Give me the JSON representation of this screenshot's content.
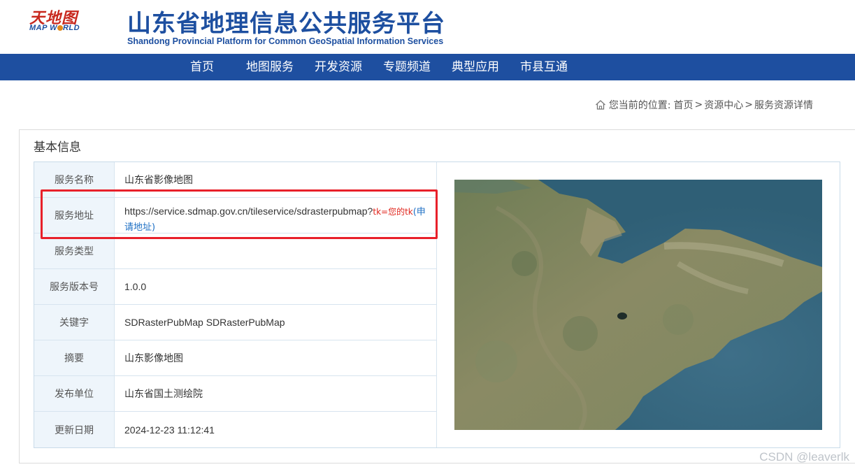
{
  "logo": {
    "cn": "天地图",
    "en_part1": "MAP W",
    "en_part2": "RLD"
  },
  "site": {
    "title": "山东省地理信息公共服务平台",
    "subtitle": "Shandong Provincial Platform for Common GeoSpatial Information Services"
  },
  "nav": {
    "items": [
      {
        "label": "首页"
      },
      {
        "label": "地图服务"
      },
      {
        "label": "开发资源"
      },
      {
        "label": "专题频道"
      },
      {
        "label": "典型应用"
      },
      {
        "label": "市县互通"
      }
    ]
  },
  "breadcrumb": {
    "prefix": "您当前的位置:",
    "home": "首页",
    "sep1": ">",
    "resource_center": "资源中心",
    "sep2": ">",
    "current": "服务资源详情"
  },
  "panel": {
    "title": "基本信息"
  },
  "info": {
    "rows": [
      {
        "label": "服务名称",
        "value": "山东省影像地图"
      },
      {
        "label": "服务地址",
        "value": "https://service.sdmap.gov.cn/tileservice/sdrasterpubmap?",
        "tk": "tk=您的tk",
        "apply": "(申请地址)"
      },
      {
        "label": "服务类型",
        "value": ""
      },
      {
        "label": "服务版本号",
        "value": "1.0.0"
      },
      {
        "label": "关键字",
        "value": "SDRasterPubMap SDRasterPubMap"
      },
      {
        "label": "摘要",
        "value": "山东影像地图"
      },
      {
        "label": "发布单位",
        "value": "山东省国土测绘院"
      },
      {
        "label": "更新日期",
        "value": "2024-12-23 11:12:41"
      }
    ]
  },
  "watermark": "CSDN @leaverlk",
  "colors": {
    "brand": "#1e4fa0",
    "highlight": "#e8202a",
    "tk": "#e0241b",
    "link": "#1d6fc4",
    "label_bg": "#eef5fb"
  }
}
